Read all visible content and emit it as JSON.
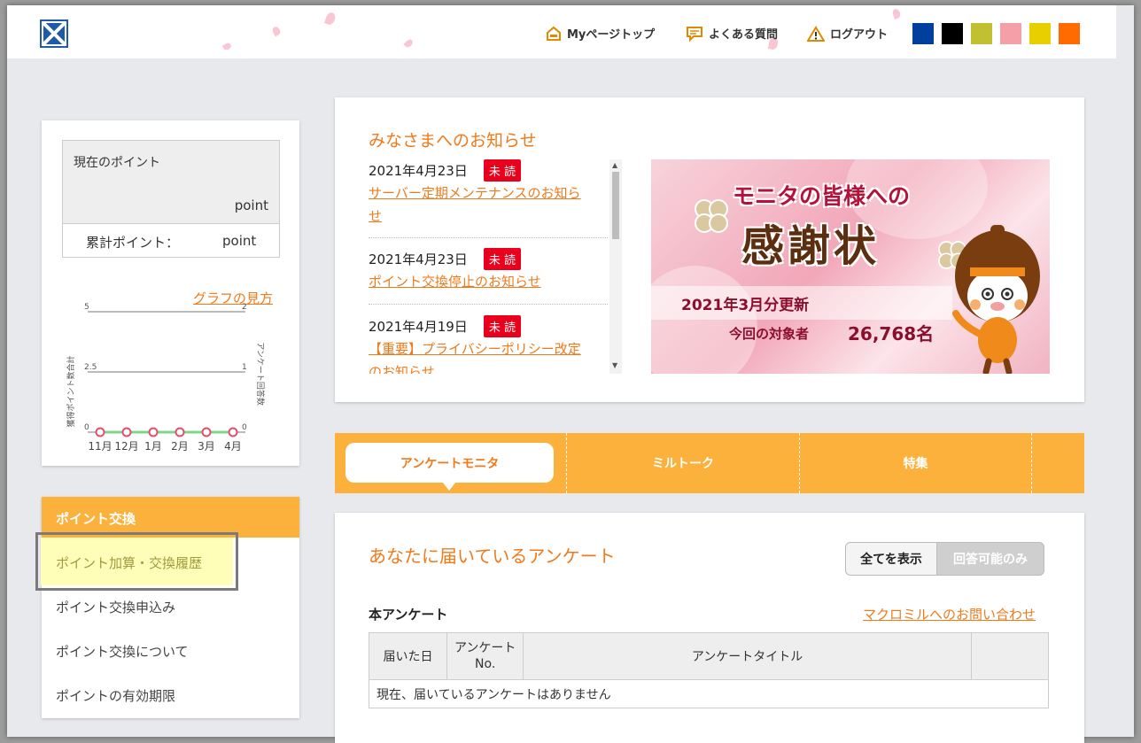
{
  "header": {
    "mypage_label": "Myページトップ",
    "faq_label": "よくある質問",
    "logout_label": "ログアウト",
    "theme_colors": [
      "#003f9e",
      "#000000",
      "#c0c030",
      "#f5a0a8",
      "#e8cf00",
      "#ff6b00"
    ]
  },
  "points": {
    "current_label": "現在のポイント",
    "current_unit": "point",
    "total_label": "累計ポイント：",
    "total_unit": "point"
  },
  "graph": {
    "help_link": "グラフの見方"
  },
  "chart_data": {
    "type": "line",
    "categories": [
      "11月",
      "12月",
      "1月",
      "2月",
      "3月",
      "4月"
    ],
    "series": [
      {
        "name": "獲得ポイント数合計",
        "values": [
          0,
          0,
          0,
          0,
          0,
          0
        ]
      },
      {
        "name": "アンケート回答数",
        "values": [
          0,
          0,
          0,
          0,
          0,
          0
        ]
      }
    ],
    "ylabel": "獲得ポイント数合計",
    "y2label": "アンケート回答数",
    "ylim": [
      0,
      5
    ],
    "y2lim": [
      0,
      2
    ],
    "yticks": [
      "5",
      "2.5",
      "0"
    ],
    "y2ticks": [
      "2",
      "1",
      "0"
    ]
  },
  "side_menu": {
    "heading": "ポイント交換",
    "items": [
      "ポイント加算・交換履歴",
      "ポイント交換申込み",
      "ポイント交換について",
      "ポイントの有効期限"
    ]
  },
  "news": {
    "heading": "みなさまへのお知らせ",
    "items": [
      {
        "date": "2021年4月23日",
        "badge": "未 読",
        "title_line1": "サーバー定期メンテナンスのお知ら",
        "title_line2": "せ"
      },
      {
        "date": "2021年4月23日",
        "badge": "未 読",
        "title_line1": "ポイント交換停止のお知らせ",
        "title_line2": ""
      },
      {
        "date": "2021年4月19日",
        "badge": "未 読",
        "title_line1": "【重要】プライバシーポリシー改定",
        "title_line2": "のお知らせ"
      }
    ],
    "banner": {
      "line1": "モニタの皆様への",
      "line2": "感謝状",
      "line3": "2021年3月分更新",
      "line4": "今回の対象者",
      "count": "26,768名"
    }
  },
  "tabs": [
    "アンケートモニタ",
    "ミルトーク",
    "特集"
  ],
  "survey": {
    "heading": "あなたに届いているアンケート",
    "show_all": "全てを表示",
    "answerable_only": "回答可能のみ",
    "subheading": "本アンケート",
    "contact_link": "マクロミルへのお問い合わせ",
    "columns": [
      "届いた日",
      "アンケート\nNo.",
      "アンケートタイトル",
      ""
    ],
    "empty_message": "現在、届いているアンケートはありません"
  }
}
